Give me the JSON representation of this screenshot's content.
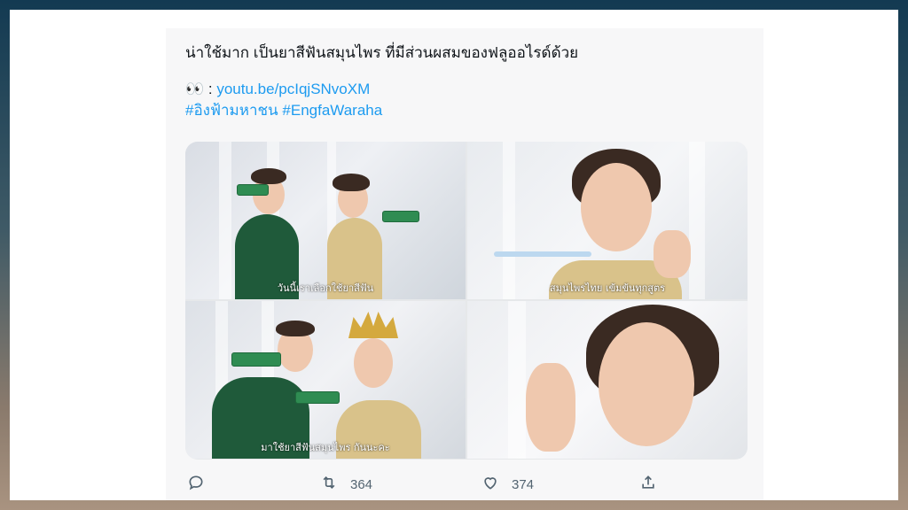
{
  "tweet": {
    "text_line1": "น่าใช้มาก เป็นยาสีฟันสมุนไพร ที่มีส่วนผสมของฟลูออไรด์ด้วย",
    "emoji": "👀",
    "link_prefix": " : ",
    "link": "youtu.be/pcIqjSNvoXM",
    "hashtag1": "#อิงฟ้ามหาชน",
    "hashtag2": "#EngfaWaraha"
  },
  "media": {
    "captions": [
      "วันนี้เราเลือกใช้ยาสีฟัน",
      "สมุนไพรไทย เข้มข้นทุกสูตร",
      "มาใช้ยาสีฟันสมุนไพร กันนะคะ",
      ""
    ]
  },
  "actions": {
    "reply_icon": "reply-icon",
    "retweet_icon": "retweet-icon",
    "retweet_count": "364",
    "like_icon": "heart-icon",
    "like_count": "374",
    "share_icon": "share-icon"
  },
  "colors": {
    "link": "#1d9bf0",
    "text": "#0f1419",
    "muted": "#536471",
    "suit_green": "#1f5a3a"
  }
}
